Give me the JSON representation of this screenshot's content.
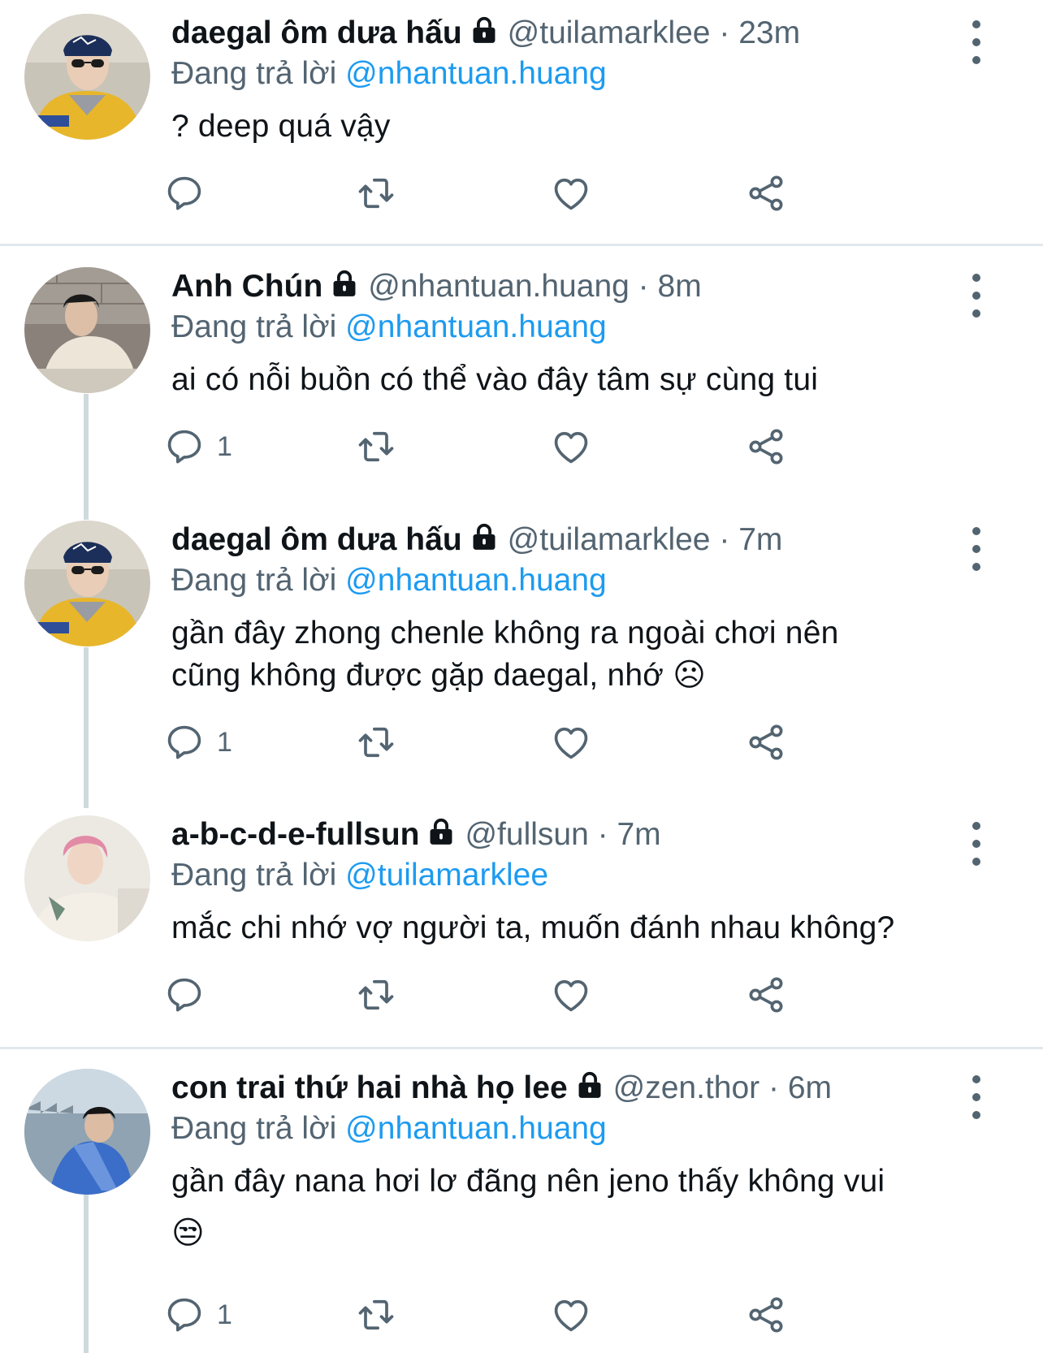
{
  "colors": {
    "accent": "#1d9bf0",
    "secondary_text": "#536471",
    "thread_line": "#cfd9de"
  },
  "reply_prefix": "Đang trả lời",
  "tweets": [
    {
      "name": "daegal ôm dưa hấu",
      "handle": "@tuilamarklee",
      "sep": "·",
      "time": "23m",
      "replying_to": "@nhantuan.huang",
      "text": "? deep quá vậy",
      "reply_count": "",
      "avatar": "yellow-hoodie-bandana"
    },
    {
      "name": "Anh Chún",
      "handle": "@nhantuan.huang",
      "sep": "·",
      "time": "8m",
      "replying_to": "@nhantuan.huang",
      "text": "ai có nỗi buồn có thể vào đây tâm sự cùng tui",
      "reply_count": "1",
      "avatar": "sweater-wall"
    },
    {
      "name": "daegal ôm dưa hấu",
      "handle": "@tuilamarklee",
      "sep": "·",
      "time": "7m",
      "replying_to": "@nhantuan.huang",
      "text_line1": "gần đây zhong chenle không ra ngoài chơi nên",
      "text_line2": "cũng không được gặp daegal, nhớ ☹",
      "reply_count": "1",
      "avatar": "yellow-hoodie-bandana"
    },
    {
      "name": "a-b-c-d-e-fullsun",
      "handle": "@fullsun",
      "sep": "·",
      "time": "7m",
      "replying_to": "@tuilamarklee",
      "text": "mắc chi nhớ vợ người ta, muốn đánh nhau không?",
      "reply_count": "",
      "avatar": "pink-hair"
    },
    {
      "name": "con trai thứ hai nhà họ lee",
      "handle": "@zen.thor",
      "sep": "·",
      "time": "6m",
      "replying_to": "@nhantuan.huang",
      "text_line1": "gần đây nana hơi lơ đãng nên jeno thấy không vui",
      "text_line2": "😒",
      "reply_count": "1",
      "avatar": "blue-jacket-sea"
    }
  ]
}
